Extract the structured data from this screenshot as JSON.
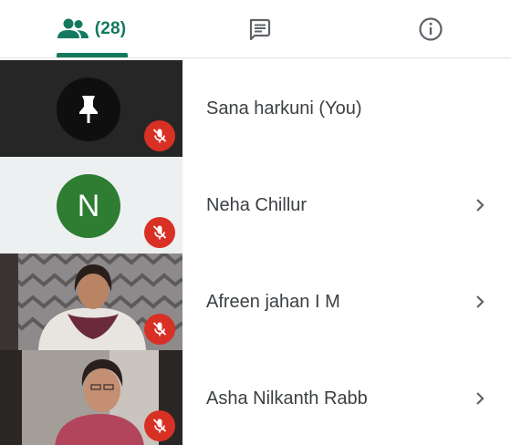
{
  "tabs": {
    "people": {
      "icon": "people-icon",
      "count": "(28)",
      "selected": true
    },
    "chat": {
      "icon": "chat-icon"
    },
    "info": {
      "icon": "info-icon"
    }
  },
  "colors": {
    "accent": "#137a5f",
    "mute_badge": "#d93025",
    "avatar_green": "#2e7d32",
    "text": "#3c4043"
  },
  "participants": [
    {
      "name": "Sana harkuni (You)",
      "avatar": "pin-icon",
      "muted": true,
      "has_chevron": false
    },
    {
      "name": "Neha Chillur",
      "avatar_letter": "N",
      "muted": true,
      "has_chevron": true
    },
    {
      "name": "Afreen jahan I M",
      "avatar": "video-thumbnail",
      "muted": true,
      "has_chevron": true
    },
    {
      "name": "Asha Nilkanth Rabb",
      "avatar": "video-thumbnail",
      "muted": true,
      "has_chevron": true
    }
  ]
}
